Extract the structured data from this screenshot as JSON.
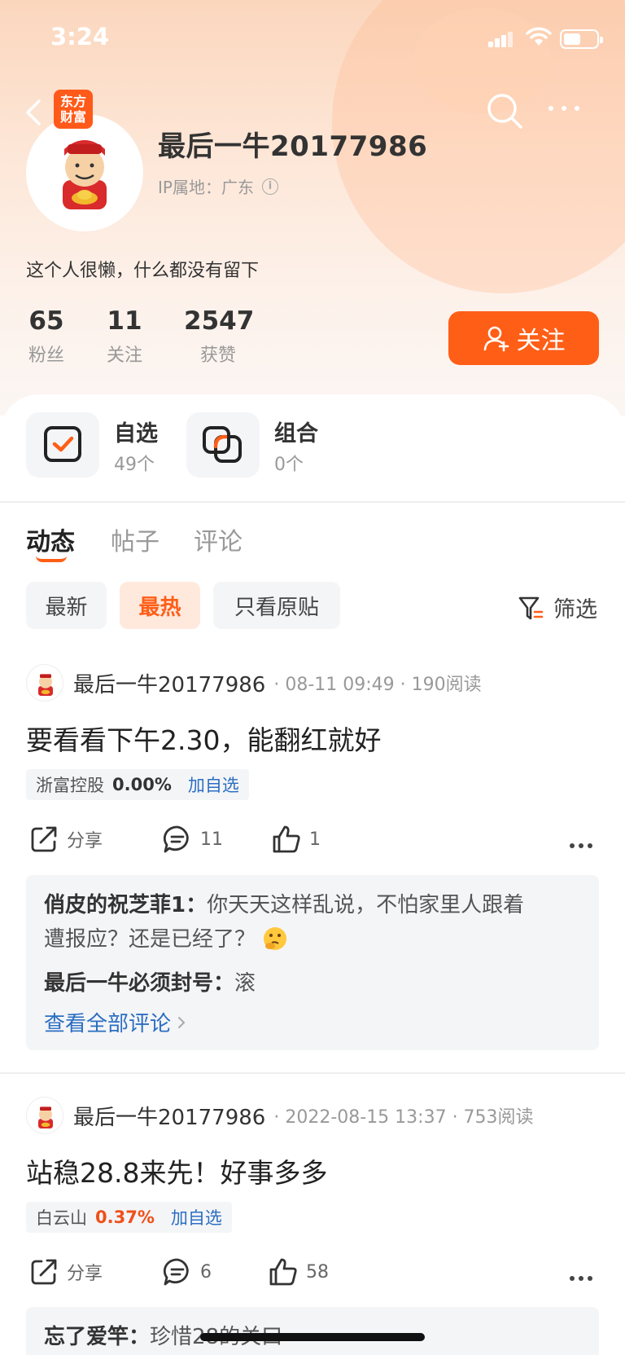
{
  "status_bar": {
    "time": "3:24"
  },
  "profile": {
    "badge_line1": "东方",
    "badge_line2": "财富",
    "username": "最后一牛20177986",
    "ip_label": "IP属地：广东",
    "bio": "这个人很懒，什么都没有留下",
    "stats": [
      {
        "num": "65",
        "label": "粉丝"
      },
      {
        "num": "11",
        "label": "关注"
      },
      {
        "num": "2547",
        "label": "获赞"
      }
    ],
    "follow_label": "关注"
  },
  "quick_links": [
    {
      "title": "自选",
      "sub": "49个",
      "icon": "watchlist-check-icon"
    },
    {
      "title": "组合",
      "sub": "0个",
      "icon": "portfolio-icon"
    }
  ],
  "tabs": [
    {
      "label": "动态"
    },
    {
      "label": "帖子"
    },
    {
      "label": "评论"
    }
  ],
  "filters": {
    "chips": [
      {
        "label": "最新"
      },
      {
        "label": "最热"
      },
      {
        "label": "只看原贴"
      }
    ],
    "filter_label": "筛选"
  },
  "posts": [
    {
      "author": "最后一牛20177986",
      "meta": "· 08-11 09:49 · 190阅读",
      "text": "要看看下午2.30，能翻红就好",
      "stock": {
        "name": "浙富控股",
        "change": "0.00%",
        "add": "加自选",
        "change_color": "#333333"
      },
      "share": "分享",
      "comments_count": "11",
      "likes": "1",
      "comments": [
        {
          "user": "俏皮的祝芝菲1：",
          "text": "你天天这样乱说，不怕家里人跟着",
          "text2": "遭报应？还是已经了？"
        },
        {
          "user": "最后一牛必须封号：",
          "text": "滚"
        }
      ],
      "see_all": "查看全部评论"
    },
    {
      "author": "最后一牛20177986",
      "meta": "· 2022-08-15 13:37 · 753阅读",
      "text": "站稳28.8来先！好事多多",
      "stock": {
        "name": "白云山",
        "change": "0.37%",
        "add": "加自选",
        "change_color": "#f0501a"
      },
      "share": "分享",
      "comments_count": "6",
      "likes": "58",
      "comments": [
        {
          "user": "忘了爱竿：",
          "text": "珍惜28的关口"
        }
      ]
    }
  ],
  "colors": {
    "accent": "#ff5e17",
    "link": "#2b6ec2",
    "rise": "#f0501a"
  }
}
